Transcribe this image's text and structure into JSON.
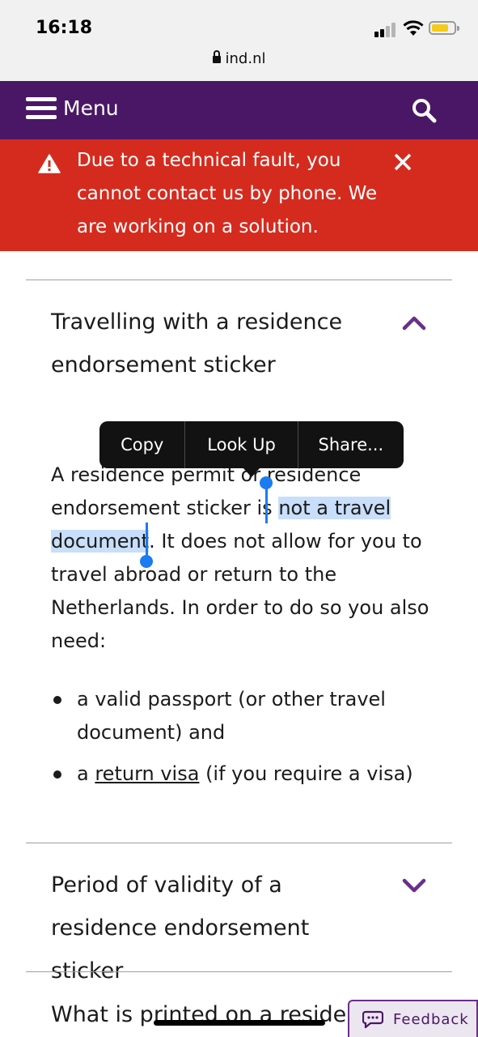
{
  "status": {
    "time": "16:18",
    "url": "ind.nl",
    "battery_color": "#f3cc1a"
  },
  "nav": {
    "menu_label": "Menu",
    "background": "#4a1766"
  },
  "alert": {
    "text": "Due to a technical fault, you cannot contact us by phone. We are working on a solution.",
    "background": "#d52b1e"
  },
  "accordion": [
    {
      "title": "Travelling with a residence endorsement sticker",
      "expanded": true
    },
    {
      "title": "Period of validity of a residence endorsement sticker",
      "expanded": false
    },
    {
      "title": "What is printed on a residence",
      "expanded": false
    }
  ],
  "content": {
    "para_before": "A residence permit or residence endorsement sticker is ",
    "para_selected": "not a travel document",
    "para_after": ". It does not allow for you to travel abroad or return to the Netherlands. In order to do so you also need:",
    "bullet1": "a valid passport (or other travel document) and",
    "bullet2_prefix": "a ",
    "bullet2_link": "return visa",
    "bullet2_suffix": " (if you require a visa)"
  },
  "callout": {
    "copy": "Copy",
    "lookup": "Look Up",
    "share": "Share..."
  },
  "feedback": {
    "label": "Feedback"
  }
}
